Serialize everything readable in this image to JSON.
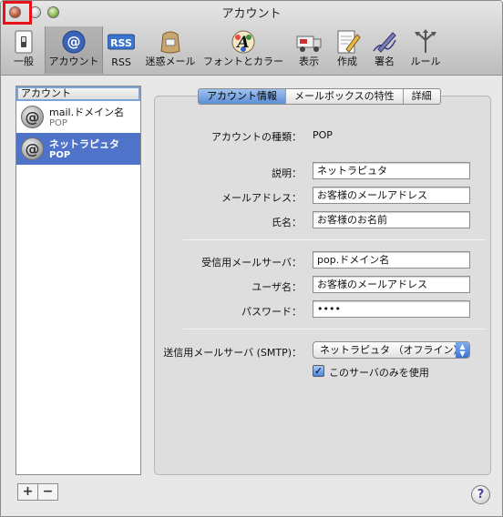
{
  "window": {
    "title": "アカウント"
  },
  "toolbar": {
    "items": [
      {
        "label": "一般",
        "icon": "general-switch-icon"
      },
      {
        "label": "アカウント",
        "icon": "at-sign-icon"
      },
      {
        "label": "RSS",
        "icon": "rss-icon"
      },
      {
        "label": "迷惑メール",
        "icon": "junk-mail-bag-icon"
      },
      {
        "label": "フォントとカラー",
        "icon": "font-color-a-icon"
      },
      {
        "label": "表示",
        "icon": "view-postal-truck-icon"
      },
      {
        "label": "作成",
        "icon": "compose-pencil-icon"
      },
      {
        "label": "署名",
        "icon": "signature-pen-icon"
      },
      {
        "label": "ルール",
        "icon": "rules-arrows-icon"
      }
    ]
  },
  "sidebar": {
    "header": "アカウント",
    "accounts": [
      {
        "name": "mail.ドメイン名",
        "type": "POP"
      },
      {
        "name": "ネットラピュタ",
        "type": "POP"
      }
    ],
    "add_label": "+",
    "remove_label": "−"
  },
  "tabs": [
    "アカウント情報",
    "メールボックスの特性",
    "詳細"
  ],
  "account_info": {
    "type_label": "アカウントの種類：",
    "type_value": "POP",
    "description_label": "説明：",
    "description_value": "ネットラピュタ",
    "email_label": "メールアドレス：",
    "email_value": "お客様のメールアドレス",
    "fullname_label": "氏名：",
    "fullname_value": "お客様のお名前",
    "incoming_server_label": "受信用メールサーバ：",
    "incoming_server_value": "pop.ドメイン名",
    "username_label": "ユーザ名：",
    "username_value": "お客様のメールアドレス",
    "password_label": "パスワード：",
    "password_value": "••••",
    "smtp_label": "送信用メールサーバ (SMTP)：",
    "smtp_value": "ネットラピュタ （オフライン）",
    "only_this_server_label": "このサーバのみを使用",
    "only_this_server_checked": true
  },
  "help_label": "?",
  "colors": {
    "selection": "#4f73c8",
    "highlight_box": "#e8111a",
    "accent_blue": "#5d8fd6"
  }
}
